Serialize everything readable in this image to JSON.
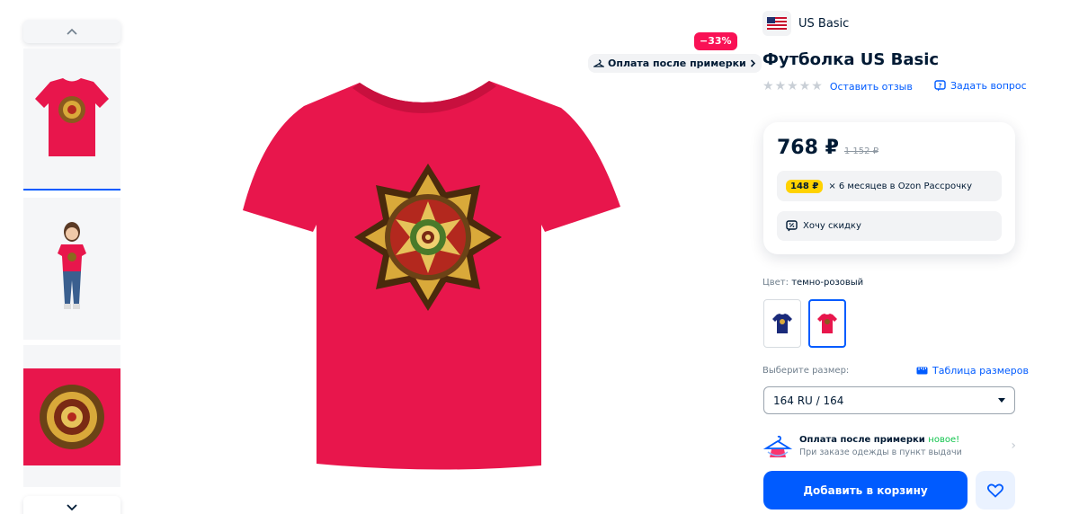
{
  "gallery": {
    "discount": "−33%",
    "fitting_chip": "Оплата после примерки"
  },
  "product": {
    "brand": "US Basic",
    "title": "Футболка US Basic",
    "review_link": "Оставить отзыв",
    "ask_link": "Задать вопрос"
  },
  "price": {
    "current": "768 ₽",
    "old": "1 152 ₽",
    "installment_amount": "148 ₽",
    "installment_text": "× 6 месяцев в Ozon Рассрочку",
    "want_discount": "Хочу скидку"
  },
  "color": {
    "label": "Цвет:",
    "value": "темно-розовый",
    "options": [
      "navy",
      "crimson"
    ]
  },
  "size": {
    "label": "Выберите размер:",
    "table_link": "Таблица размеров",
    "selected": "164 RU / 164"
  },
  "fitting": {
    "title": "Оплата после примерки",
    "badge": "новое!",
    "subtitle": "При заказе одежды в пункт выдачи"
  },
  "actions": {
    "add_to_cart": "Добавить в корзину"
  },
  "colors": {
    "accent": "#005bff",
    "discount": "#f91155",
    "shirt": "#e8164c"
  }
}
